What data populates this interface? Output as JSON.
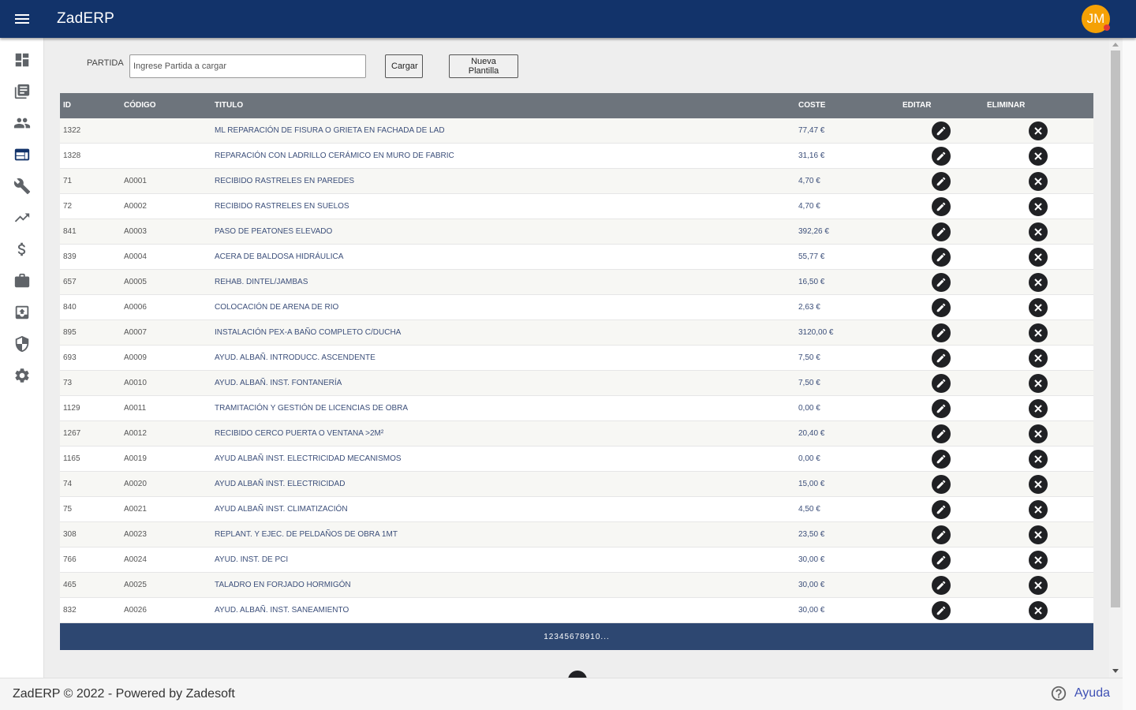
{
  "app": {
    "title": "ZadERP",
    "user_initials": "JM"
  },
  "sidebar": {
    "items": [
      {
        "icon": "dashboard-icon"
      },
      {
        "icon": "library-books-icon"
      },
      {
        "icon": "people-icon"
      },
      {
        "icon": "web-icon"
      },
      {
        "icon": "wrench-icon"
      },
      {
        "icon": "trending-up-icon"
      },
      {
        "icon": "dollar-icon"
      },
      {
        "icon": "briefcase-icon"
      },
      {
        "icon": "archive-icon"
      },
      {
        "icon": "shield-icon"
      },
      {
        "icon": "gear-icon"
      }
    ]
  },
  "toolbar": {
    "partida_label": "PARTIDA",
    "partida_placeholder": "Ingrese Partida a cargar",
    "partida_value": "",
    "cargar_label": "Cargar",
    "nueva_label": "Nueva Plantilla"
  },
  "table": {
    "headers": {
      "id": "ID",
      "codigo": "CÓDIGO",
      "titulo": "TITULO",
      "coste": "COSTE",
      "editar": "EDITAR",
      "eliminar": "ELIMINAR"
    },
    "rows": [
      {
        "id": "1322",
        "codigo": "",
        "titulo": "ML REPARACIÓN DE FISURA O GRIETA EN FACHADA DE LAD",
        "coste": "77,47 €"
      },
      {
        "id": "1328",
        "codigo": "",
        "titulo": "REPARACIÓN CON LADRILLO CERÁMICO EN MURO DE FABRIC",
        "coste": "31,16 €"
      },
      {
        "id": "71",
        "codigo": "A0001",
        "titulo": "RECIBIDO RASTRELES EN PAREDES",
        "coste": "4,70 €"
      },
      {
        "id": "72",
        "codigo": "A0002",
        "titulo": "RECIBIDO RASTRELES EN SUELOS",
        "coste": "4,70 €"
      },
      {
        "id": "841",
        "codigo": "A0003",
        "titulo": "PASO DE PEATONES ELEVADO",
        "coste": "392,26 €"
      },
      {
        "id": "839",
        "codigo": "A0004",
        "titulo": "ACERA DE BALDOSA HIDRÁULICA",
        "coste": "55,77 €"
      },
      {
        "id": "657",
        "codigo": "A0005",
        "titulo": "REHAB. DINTEL/JAMBAS",
        "coste": "16,50 €"
      },
      {
        "id": "840",
        "codigo": "A0006",
        "titulo": "COLOCACIÓN DE ARENA DE RIO",
        "coste": "2,63 €"
      },
      {
        "id": "895",
        "codigo": "A0007",
        "titulo": "INSTALACIÓN PEX-A BAÑO COMPLETO C/DUCHA",
        "coste": "3120,00 €"
      },
      {
        "id": "693",
        "codigo": "A0009",
        "titulo": "AYUD. ALBAÑ. INTRODUCC. ASCENDENTE",
        "coste": "7,50 €"
      },
      {
        "id": "73",
        "codigo": "A0010",
        "titulo": "AYUD. ALBAÑ. INST. FONTANERÍA",
        "coste": "7,50 €"
      },
      {
        "id": "1129",
        "codigo": "A0011",
        "titulo": "TRAMITACIÓN Y GESTIÓN DE LICENCIAS DE OBRA",
        "coste": "0,00 €"
      },
      {
        "id": "1267",
        "codigo": "A0012",
        "titulo": "RECIBIDO CERCO PUERTA O VENTANA >2M²",
        "coste": "20,40 €"
      },
      {
        "id": "1165",
        "codigo": "A0019",
        "titulo": "AYUD ALBAÑ INST. ELECTRICIDAD MECANISMOS",
        "coste": "0,00 €"
      },
      {
        "id": "74",
        "codigo": "A0020",
        "titulo": "AYUD ALBAÑ INST. ELECTRICIDAD",
        "coste": "15,00 €"
      },
      {
        "id": "75",
        "codigo": "A0021",
        "titulo": "AYUD ALBAÑ INST. CLIMATIZACIÓN",
        "coste": "4,50 €"
      },
      {
        "id": "308",
        "codigo": "A0023",
        "titulo": "REPLANT. Y EJEC. DE PELDAÑOS DE OBRA 1MT",
        "coste": "23,50 €"
      },
      {
        "id": "766",
        "codigo": "A0024",
        "titulo": "AYUD. INST. DE PCI",
        "coste": "30,00 €"
      },
      {
        "id": "465",
        "codigo": "A0025",
        "titulo": "TALADRO EN FORJADO HORMIGÓN",
        "coste": "30,00 €"
      },
      {
        "id": "832",
        "codigo": "A0026",
        "titulo": "AYUD. ALBAÑ. INST. SANEAMIENTO",
        "coste": "30,00 €"
      }
    ]
  },
  "pager": {
    "pages": [
      "1",
      "2",
      "3",
      "4",
      "5",
      "6",
      "7",
      "8",
      "9",
      "10"
    ],
    "more": "..."
  },
  "footer": {
    "text": "ZadERP © 2022 - Powered by Zadesoft",
    "help_label": "Ayuda"
  },
  "colors": {
    "topbar": "#12336a",
    "avatar": "#f5a105",
    "pager": "#2d4771",
    "table_header": "#6d747c",
    "help_link": "#3f51b5"
  }
}
